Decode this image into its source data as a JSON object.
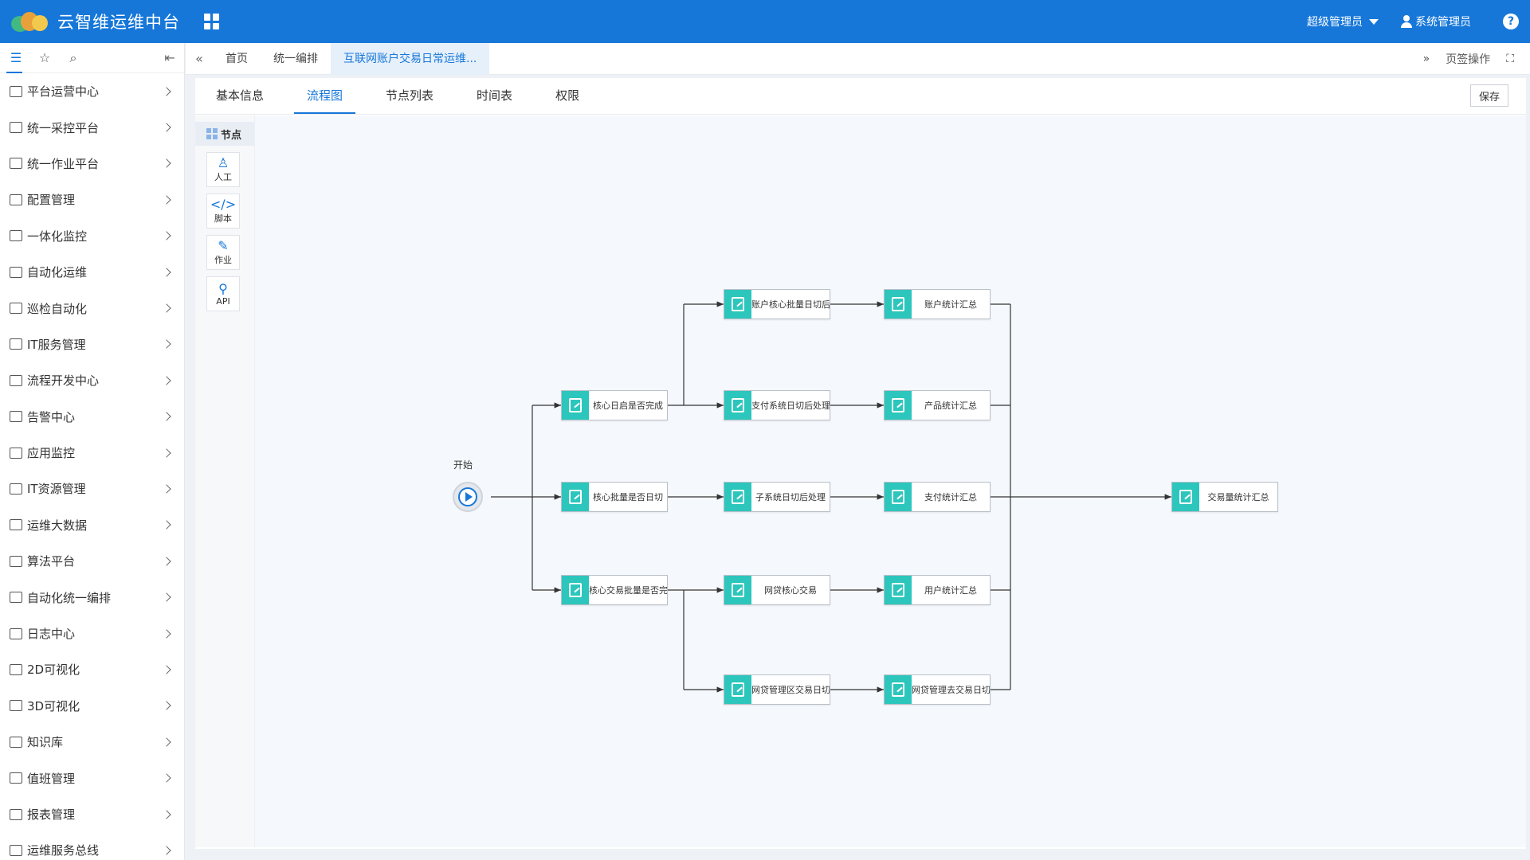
{
  "header": {
    "title": "云智维运维中台",
    "role": "超级管理员",
    "user": "系统管理员",
    "help": "?",
    "brand_color": "#1677d9"
  },
  "sidebar": {
    "items": [
      {
        "label": "平台运营中心"
      },
      {
        "label": "统一采控平台"
      },
      {
        "label": "统一作业平台"
      },
      {
        "label": "配置管理"
      },
      {
        "label": "一体化监控"
      },
      {
        "label": "自动化运维"
      },
      {
        "label": "巡检自动化"
      },
      {
        "label": "IT服务管理"
      },
      {
        "label": "流程开发中心"
      },
      {
        "label": "告警中心"
      },
      {
        "label": "应用监控"
      },
      {
        "label": "IT资源管理"
      },
      {
        "label": "运维大数据"
      },
      {
        "label": "算法平台"
      },
      {
        "label": "自动化统一编排"
      },
      {
        "label": "日志中心"
      },
      {
        "label": "2D可视化"
      },
      {
        "label": "3D可视化"
      },
      {
        "label": "知识库"
      },
      {
        "label": "值班管理"
      },
      {
        "label": "报表管理"
      },
      {
        "label": "运维服务总线"
      }
    ]
  },
  "tabs": {
    "items": [
      "首页",
      "统一编排",
      "互联网账户交易日常运维..."
    ],
    "page_ops": "页签操作"
  },
  "subtabs": {
    "items": [
      "基本信息",
      "流程图",
      "节点列表",
      "时间表",
      "权限"
    ],
    "save": "保存"
  },
  "palette": {
    "title": "节点",
    "items": [
      {
        "label": "人工",
        "icon": "person-icon"
      },
      {
        "label": "脚本",
        "icon": "script-icon"
      },
      {
        "label": "作业",
        "icon": "job-icon"
      },
      {
        "label": "API",
        "icon": "api-icon"
      }
    ]
  },
  "flow": {
    "start_label": "开始",
    "node_color": "#2cc6bd",
    "nodes": {
      "n1": "核心日启是否完成",
      "n2": "核心批量是否日切",
      "n3": "核心交易批量是否完",
      "n4": "账户核心批量日切后",
      "n5": "支付系统日切后处理",
      "n6": "子系统日切后处理",
      "n7": "网贷核心交易",
      "n8": "网贷管理区交易日切",
      "n9": "账户统计汇总",
      "n10": "产品统计汇总",
      "n11": "支付统计汇总",
      "n12": "用户统计汇总",
      "n13": "网贷管理去交易日切",
      "n14": "交易量统计汇总"
    }
  }
}
